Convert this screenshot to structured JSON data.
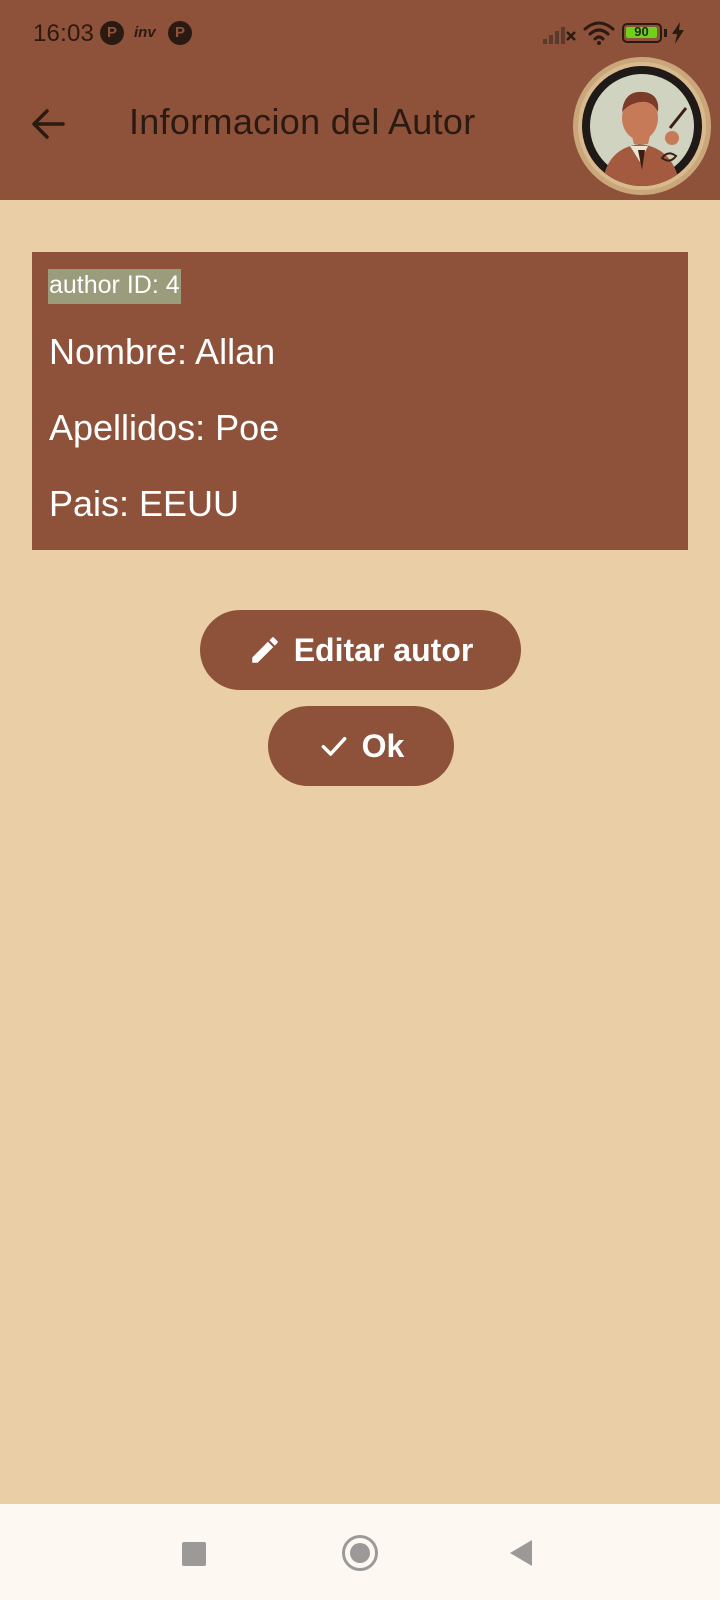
{
  "status_bar": {
    "time": "16:03",
    "notification_icons": [
      "P",
      "inv",
      "P"
    ],
    "battery_level": "90",
    "icons": [
      "signal-x-icon",
      "wifi-icon",
      "battery-icon",
      "charging-bolt-icon"
    ]
  },
  "app_bar": {
    "title": "Informacion del Autor",
    "back_icon": "arrow-left-icon",
    "avatar": "author-portrait-avatar"
  },
  "author": {
    "id_label": "author ID: 4",
    "name_line": "Nombre: Allan",
    "surname_line": "Apellidos: Poe",
    "country_line": "Pais: EEUU"
  },
  "actions": {
    "edit_label": "Editar autor",
    "edit_icon": "pencil-icon",
    "ok_label": "Ok",
    "ok_icon": "check-icon"
  },
  "nav_bar": {
    "icons": [
      "recents-square-icon",
      "home-circle-icon",
      "back-triangle-icon"
    ]
  },
  "colors": {
    "primary": "#8E523A",
    "background": "#EACEA6",
    "id_highlight": "#9A9C7B",
    "nav_background": "#FDF8F2",
    "on_primary": "#FFFFFF"
  }
}
